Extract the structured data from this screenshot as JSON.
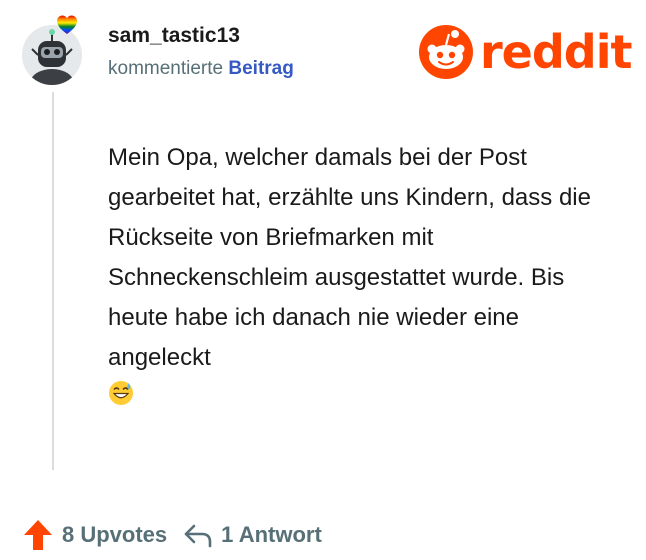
{
  "post": {
    "username": "sam_tastic13",
    "action_verb": "kommentierte",
    "action_link": "Beitrag",
    "avatar_icon": "avatar-robot-icon",
    "badge_icon": "rainbow-heart-icon"
  },
  "brand": {
    "name": "reddit",
    "icon": "reddit-snoo-icon",
    "color": "#ff4500"
  },
  "comment": {
    "text": "Mein Opa, welcher damals bei der Post gearbeitet hat, erzählte uns Kindern, dass die Rückseite von Briefmarken mit Schneckenschleim ausgestattet wurde. Bis heute habe ich danach nie wieder eine angeleckt",
    "emoji_icon": "grinning-sweat-emoji-icon"
  },
  "footer": {
    "upvotes_label": "8 Upvotes",
    "replies_label": "1 Antwort",
    "upvote_color": "#ff4500"
  }
}
